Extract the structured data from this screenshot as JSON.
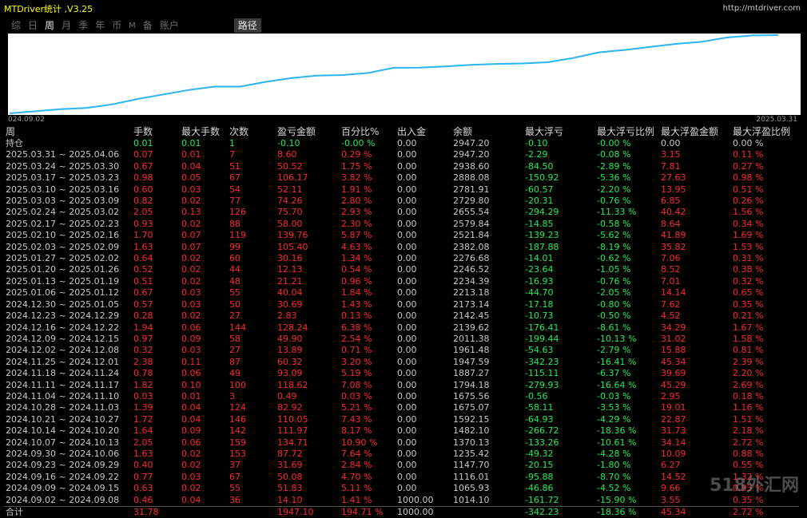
{
  "app": {
    "title": "MTDriver统计 ,V3.25",
    "url": "http://mtdriver.com"
  },
  "tabs": [
    {
      "label": "综"
    },
    {
      "label": "日"
    },
    {
      "label": "周"
    },
    {
      "label": "月"
    },
    {
      "label": "季"
    },
    {
      "label": "年"
    },
    {
      "label": "币"
    },
    {
      "label": "M"
    },
    {
      "label": "备"
    },
    {
      "label": "账户"
    },
    {
      "label": "路径"
    }
  ],
  "active_tab": "周",
  "chart": {
    "start_label": "024.09.02",
    "end_label": "2025.03.31",
    "line_color": "#2ab4f0",
    "balance_series": [
      1014.1,
      1065.93,
      1116.01,
      1147.7,
      1235.42,
      1370.13,
      1482.1,
      1592.15,
      1675.07,
      1675.56,
      1794.18,
      1887.27,
      1947.59,
      1961.48,
      2011.38,
      2139.62,
      2142.45,
      2173.14,
      2213.18,
      2234.39,
      2246.52,
      2276.68,
      2382.08,
      2521.84,
      2579.84,
      2655.54,
      2729.8,
      2781.91,
      2888.08,
      2938.6,
      2947.2
    ]
  },
  "colors": {
    "profit": "#ff2a2a",
    "loss": "#22ee55",
    "title": "#ffff00",
    "neutral": "#c8c8c8"
  },
  "headers": [
    "周",
    "手数",
    "最大手数",
    "次数",
    "盈亏金额",
    "百分比%",
    "出入金",
    "余额",
    "最大浮亏",
    "最大浮亏比例",
    "最大浮盈金额",
    "最大浮盈比例"
  ],
  "holding": [
    "持仓",
    "0.01",
    "0.01",
    "1",
    "-0.10",
    "-0.00 %",
    "0.00",
    "2947.20",
    "-0.10",
    "-0.00 %",
    "0.00",
    "0.00 %"
  ],
  "rows": [
    [
      "2025.03.31 ~ 2025.04.06",
      "0.07",
      "0.01",
      "7",
      "8.60",
      "0.29 %",
      "0.00",
      "2947.20",
      "-2.29",
      "-0.08 %",
      "3.15",
      "0.11 %"
    ],
    [
      "2025.03.24 ~ 2025.03.30",
      "0.67",
      "0.04",
      "51",
      "50.52",
      "1.75 %",
      "0.00",
      "2938.60",
      "-84.50",
      "-2.89 %",
      "7.81",
      "0.27 %"
    ],
    [
      "2025.03.17 ~ 2025.03.23",
      "0.98",
      "0.05",
      "67",
      "106.17",
      "3.82 %",
      "0.00",
      "2888.08",
      "-150.92",
      "-5.36 %",
      "27.63",
      "0.98 %"
    ],
    [
      "2025.03.10 ~ 2025.03.16",
      "0.60",
      "0.03",
      "54",
      "52.11",
      "1.91 %",
      "0.00",
      "2781.91",
      "-60.57",
      "-2.20 %",
      "13.95",
      "0.51 %"
    ],
    [
      "2025.03.03 ~ 2025.03.09",
      "0.82",
      "0.02",
      "77",
      "74.26",
      "2.80 %",
      "0.00",
      "2729.80",
      "-20.31",
      "-0.76 %",
      "6.85",
      "0.26 %"
    ],
    [
      "2025.02.24 ~ 2025.03.02",
      "2.05",
      "0.13",
      "126",
      "75.70",
      "2.93 %",
      "0.00",
      "2655.54",
      "-294.29",
      "-11.33 %",
      "40.42",
      "1.56 %"
    ],
    [
      "2025.02.17 ~ 2025.02.23",
      "0.93",
      "0.02",
      "88",
      "58.00",
      "2.30 %",
      "0.00",
      "2579.84",
      "-14.85",
      "-0.58 %",
      "8.64",
      "0.34 %"
    ],
    [
      "2025.02.10 ~ 2025.02.16",
      "1.70",
      "0.07",
      "119",
      "139.76",
      "5.87 %",
      "0.00",
      "2521.84",
      "-139.23",
      "-5.62 %",
      "41.89",
      "1.69 %"
    ],
    [
      "2025.02.03 ~ 2025.02.09",
      "1.63",
      "0.07",
      "99",
      "105.40",
      "4.63 %",
      "0.00",
      "2382.08",
      "-187.88",
      "-8.19 %",
      "35.82",
      "1.53 %"
    ],
    [
      "2025.01.27 ~ 2025.02.02",
      "0.64",
      "0.02",
      "60",
      "30.16",
      "1.34 %",
      "0.00",
      "2276.68",
      "-14.01",
      "-0.62 %",
      "7.06",
      "0.31 %"
    ],
    [
      "2025.01.20 ~ 2025.01.26",
      "0.52",
      "0.02",
      "44",
      "12.13",
      "0.54 %",
      "0.00",
      "2246.52",
      "-23.64",
      "-1.05 %",
      "8.52",
      "0.38 %"
    ],
    [
      "2025.01.13 ~ 2025.01.19",
      "0.51",
      "0.02",
      "48",
      "21.21",
      "0.96 %",
      "0.00",
      "2234.39",
      "-16.93",
      "-0.76 %",
      "7.01",
      "0.32 %"
    ],
    [
      "2025.01.06 ~ 2025.01.12",
      "0.67",
      "0.03",
      "55",
      "40.04",
      "1.84 %",
      "0.00",
      "2213.18",
      "-44.70",
      "-2.05 %",
      "14.14",
      "0.65 %"
    ],
    [
      "2024.12.30 ~ 2025.01.05",
      "0.57",
      "0.03",
      "50",
      "30.69",
      "1.43 %",
      "0.00",
      "2173.14",
      "-17.18",
      "-0.80 %",
      "7.62",
      "0.35 %"
    ],
    [
      "2024.12.23 ~ 2024.12.29",
      "0.28",
      "0.02",
      "27",
      "2.83",
      "0.13 %",
      "0.00",
      "2142.45",
      "-10.73",
      "-0.50 %",
      "4.52",
      "0.21 %"
    ],
    [
      "2024.12.16 ~ 2024.12.22",
      "1.94",
      "0.06",
      "144",
      "128.24",
      "6.38 %",
      "0.00",
      "2139.62",
      "-176.41",
      "-8.61 %",
      "34.29",
      "1.67 %"
    ],
    [
      "2024.12.09 ~ 2024.12.15",
      "0.97",
      "0.09",
      "58",
      "49.90",
      "2.54 %",
      "0.00",
      "2011.38",
      "-199.44",
      "-10.13 %",
      "31.02",
      "1.58 %"
    ],
    [
      "2024.12.02 ~ 2024.12.08",
      "0.32",
      "0.03",
      "27",
      "13.89",
      "0.71 %",
      "0.00",
      "1961.48",
      "-54.63",
      "-2.79 %",
      "15.88",
      "0.81 %"
    ],
    [
      "2024.11.25 ~ 2024.12.01",
      "2.38",
      "0.11",
      "87",
      "60.32",
      "3.20 %",
      "0.00",
      "1947.59",
      "-342.23",
      "-16.41 %",
      "45.34",
      "2.39 %"
    ],
    [
      "2024.11.18 ~ 2024.11.24",
      "0.78",
      "0.06",
      "49",
      "93.09",
      "5.19 %",
      "0.00",
      "1887.27",
      "-115.11",
      "-6.37 %",
      "39.69",
      "2.20 %"
    ],
    [
      "2024.11.11 ~ 2024.11.17",
      "1.82",
      "0.10",
      "100",
      "118.62",
      "7.08 %",
      "0.00",
      "1794.18",
      "-279.93",
      "-16.64 %",
      "45.29",
      "2.69 %"
    ],
    [
      "2024.11.04 ~ 2024.11.10",
      "0.03",
      "0.01",
      "3",
      "0.49",
      "0.03 %",
      "0.00",
      "1675.56",
      "-0.56",
      "-0.03 %",
      "2.95",
      "0.18 %"
    ],
    [
      "2024.10.28 ~ 2024.11.03",
      "1.39",
      "0.04",
      "124",
      "82.92",
      "5.21 %",
      "0.00",
      "1675.07",
      "-58.11",
      "-3.53 %",
      "19.01",
      "1.16 %"
    ],
    [
      "2024.10.21 ~ 2024.10.27",
      "1.72",
      "0.04",
      "146",
      "110.05",
      "7.43 %",
      "0.00",
      "1592.15",
      "-64.93",
      "-4.29 %",
      "22.87",
      "1.51 %"
    ],
    [
      "2024.10.14 ~ 2024.10.20",
      "1.64",
      "0.09",
      "142",
      "111.97",
      "8.17 %",
      "0.00",
      "1482.10",
      "-266.72",
      "-18.36 %",
      "31.73",
      "2.18 %"
    ],
    [
      "2024.10.07 ~ 2024.10.13",
      "2.05",
      "0.06",
      "159",
      "134.71",
      "10.90 %",
      "0.00",
      "1370.13",
      "-133.26",
      "-10.61 %",
      "34.14",
      "2.72 %"
    ],
    [
      "2024.09.30 ~ 2024.10.06",
      "1.63",
      "0.02",
      "153",
      "87.72",
      "7.64 %",
      "0.00",
      "1235.42",
      "-49.32",
      "-4.28 %",
      "10.09",
      "0.88 %"
    ],
    [
      "2024.09.23 ~ 2024.09.29",
      "0.40",
      "0.02",
      "37",
      "31.69",
      "2.84 %",
      "0.00",
      "1147.70",
      "-20.15",
      "-1.80 %",
      "6.27",
      "0.55 %"
    ],
    [
      "2024.09.16 ~ 2024.09.22",
      "0.77",
      "0.03",
      "67",
      "50.08",
      "4.70 %",
      "0.00",
      "1116.01",
      "-95.88",
      "-8.70 %",
      "14.52",
      "1.32 %"
    ],
    [
      "2024.09.09 ~ 2024.09.15",
      "0.63",
      "0.02",
      "55",
      "51.83",
      "5.11 %",
      "0.00",
      "1065.93",
      "-46.86",
      "-4.52 %",
      "9.66",
      "0.93 %"
    ],
    [
      "2024.09.02 ~ 2024.09.08",
      "0.46",
      "0.04",
      "36",
      "14.10",
      "1.41 %",
      "1000.00",
      "1014.10",
      "-161.72",
      "-15.90 %",
      "3.55",
      "0.35 %"
    ]
  ],
  "total": [
    "合计",
    "31.78",
    "",
    "",
    "1947.10",
    "194.71 %",
    "1000.00",
    "",
    "-342.23",
    "-18.36 %",
    "45.34",
    "2.72 %"
  ],
  "watermark": "518外汇网"
}
